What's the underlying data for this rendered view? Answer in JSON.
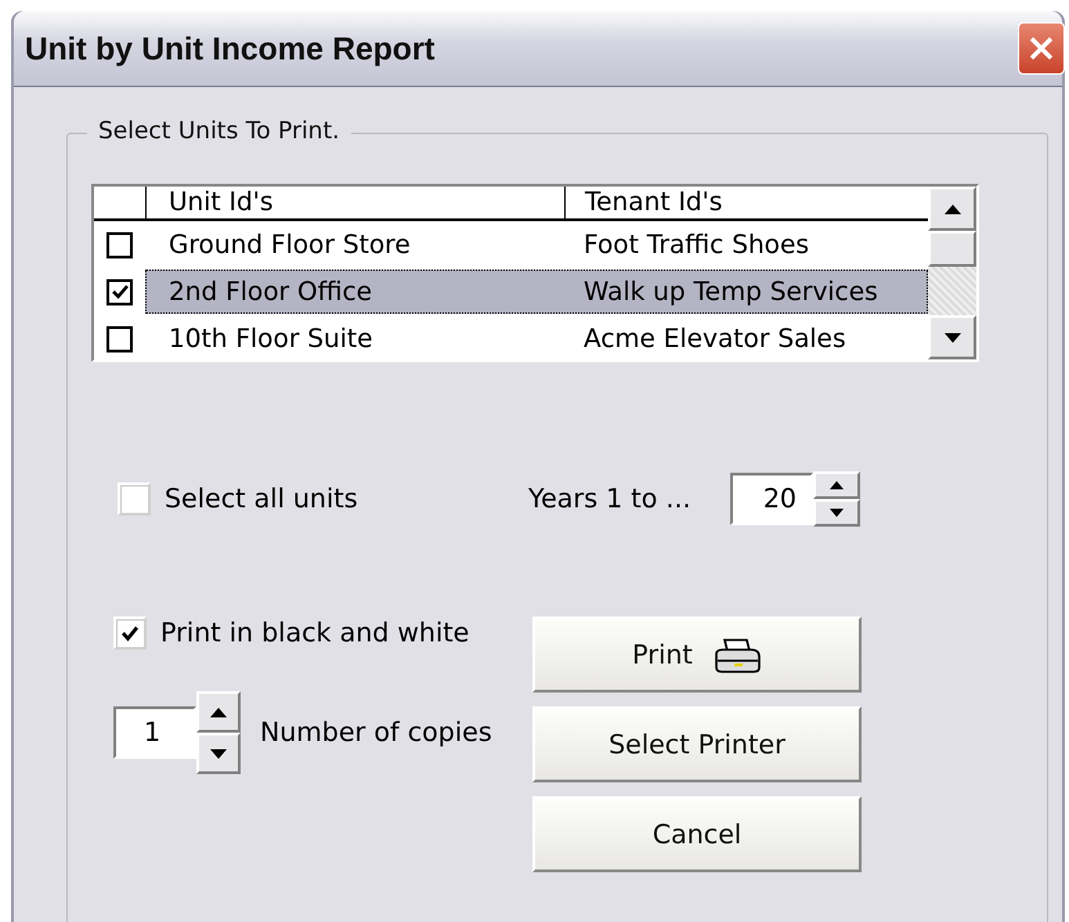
{
  "window": {
    "title": "Unit by Unit Income Report"
  },
  "group": {
    "label": "Select Units To Print."
  },
  "list": {
    "columns": [
      "Unit Id's",
      "Tenant Id's"
    ],
    "rows": [
      {
        "checked": false,
        "selected": false,
        "unit": "Ground Floor Store",
        "tenant": "Foot Traffic Shoes"
      },
      {
        "checked": true,
        "selected": true,
        "unit": "2nd Floor Office",
        "tenant": "Walk up Temp Services"
      },
      {
        "checked": false,
        "selected": false,
        "unit": "10th Floor Suite",
        "tenant": "Acme Elevator Sales"
      }
    ]
  },
  "select_all": {
    "label": "Select all units",
    "checked": false
  },
  "years": {
    "label": "Years 1 to ...",
    "value": "20"
  },
  "print_bw": {
    "label": "Print in black and white",
    "checked": true
  },
  "copies": {
    "value": "1",
    "label": "Number of copies"
  },
  "buttons": [
    {
      "label": "Print",
      "kind": "print"
    },
    {
      "label": "Select Printer",
      "kind": "plain"
    },
    {
      "label": "Cancel",
      "kind": "plain"
    }
  ]
}
